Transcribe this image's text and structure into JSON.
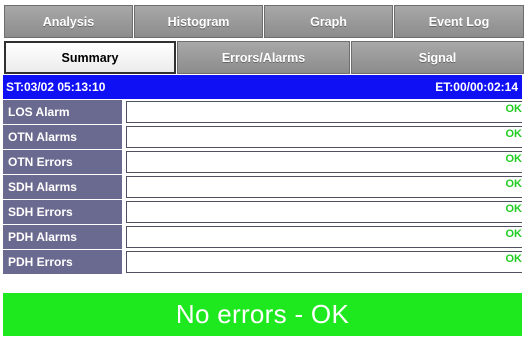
{
  "tabs_top": [
    "Analysis",
    "Histogram",
    "Graph",
    "Event Log"
  ],
  "tabs_bottom": [
    "Summary",
    "Errors/Alarms",
    "Signal"
  ],
  "status": {
    "start_time": "ST:03/02 05:13:10",
    "elapsed_time": "ET:00/00:02:14"
  },
  "rows": [
    {
      "label": "LOS Alarm",
      "status": "OK"
    },
    {
      "label": "OTN Alarms",
      "status": "OK"
    },
    {
      "label": "OTN Errors",
      "status": "OK"
    },
    {
      "label": "SDH Alarms",
      "status": "OK"
    },
    {
      "label": "SDH Errors",
      "status": "OK"
    },
    {
      "label": "PDH Alarms",
      "status": "OK"
    },
    {
      "label": "PDH Errors",
      "status": "OK"
    }
  ],
  "banner": "No errors - OK",
  "colors": {
    "status_bar": "#1010f5",
    "ok_text": "#22cc22",
    "banner": "#1ee81e",
    "row_label_bg": "#6a6a90"
  }
}
